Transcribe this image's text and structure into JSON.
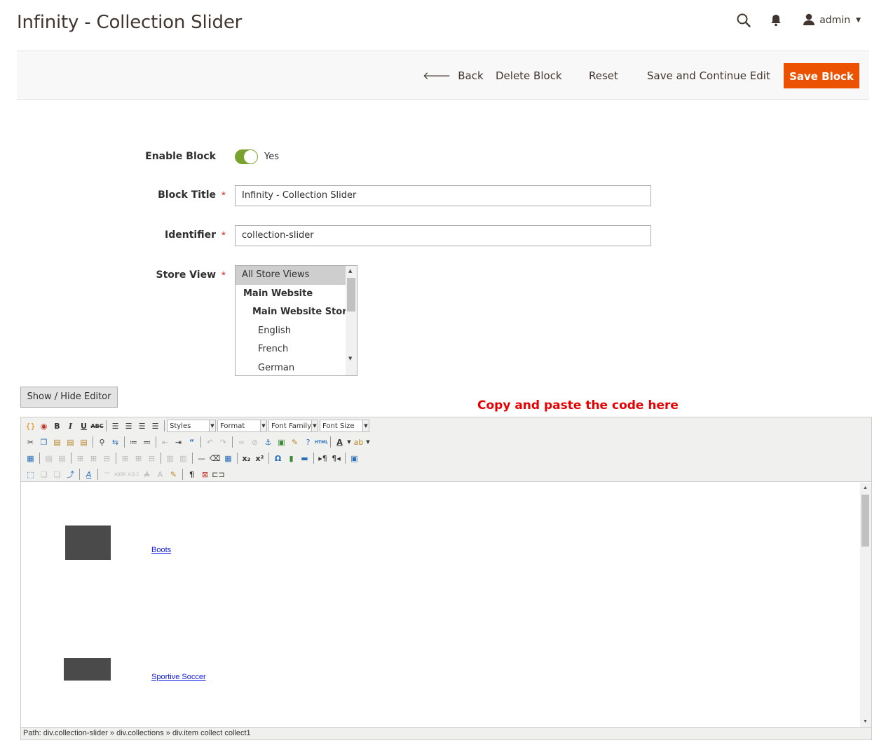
{
  "page": {
    "title": "Infinity - Collection Slider"
  },
  "header": {
    "search_icon": "search-icon",
    "notifications_icon": "bell-icon",
    "user": {
      "name": "admin",
      "icon": "user-icon"
    }
  },
  "actions": {
    "back_label": "Back",
    "delete_label": "Delete Block",
    "reset_label": "Reset",
    "save_continue_label": "Save and Continue Edit",
    "save_label": "Save Block",
    "save_color": "#eb5202"
  },
  "form": {
    "enable_block": {
      "label": "Enable Block",
      "value": "Yes",
      "enabled": true
    },
    "block_title": {
      "label": "Block Title",
      "value": "Infinity - Collection Slider"
    },
    "identifier": {
      "label": "Identifier",
      "value": "collection-slider"
    },
    "store_view": {
      "label": "Store View",
      "options": [
        {
          "label": "All Store Views",
          "selected": true
        },
        {
          "label": "Main Website",
          "selected": false
        },
        {
          "label": "Main Website Store",
          "selected": false
        },
        {
          "label": "English",
          "selected": false
        },
        {
          "label": "French",
          "selected": false
        },
        {
          "label": "German",
          "selected": false
        }
      ]
    },
    "required_mark": "*"
  },
  "editor": {
    "toggle_label": "Show / Hide Editor",
    "note": "Copy and paste the code here",
    "selects": {
      "styles": "Styles",
      "format": "Format",
      "font_family": "Font Family",
      "font_size": "Font Size"
    },
    "content": {
      "links": [
        "Boots",
        "Sportive Soccer"
      ]
    },
    "path": "Path: div.collection-slider » div.collections » div.item collect collect1"
  }
}
